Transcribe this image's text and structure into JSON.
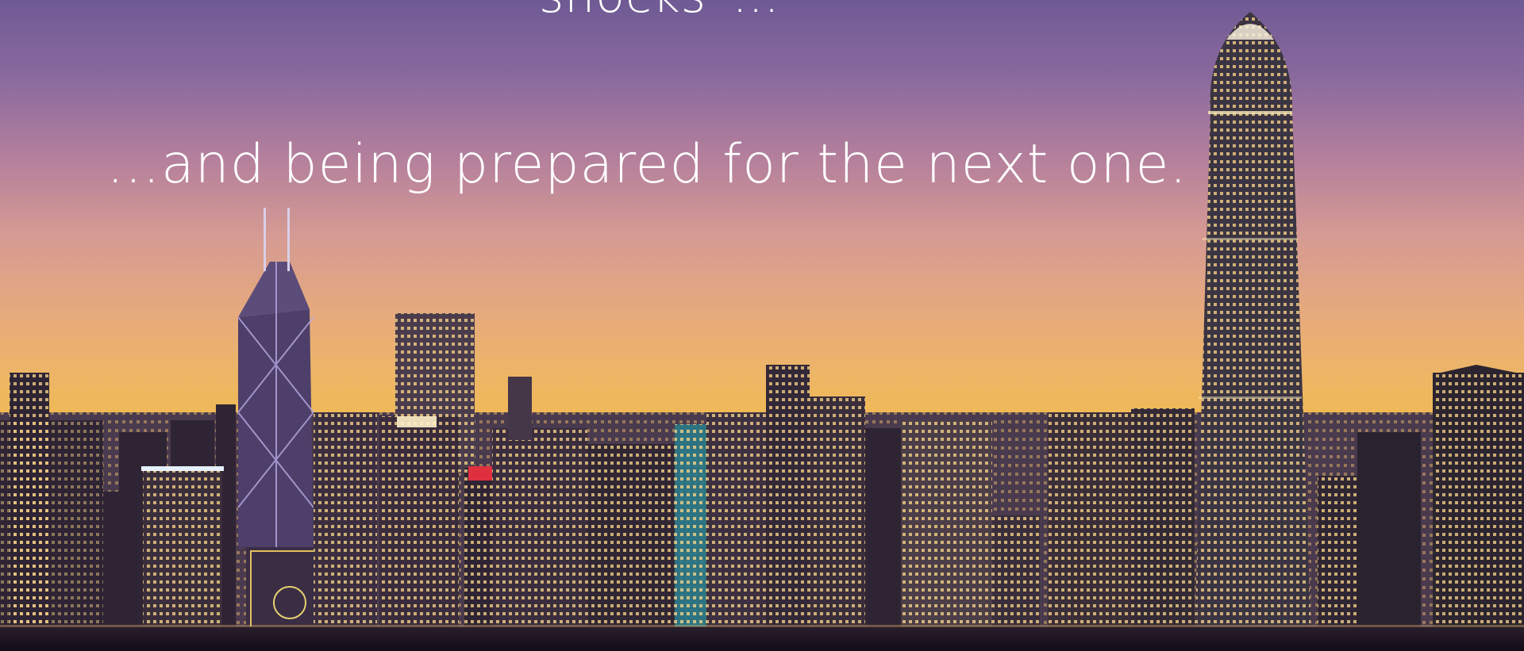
{
  "caption": {
    "line1": "“shocks”…",
    "line2": "…and being prepared for the next one."
  },
  "colors": {
    "sky_top": "#6f5a94",
    "sky_mid": "#d59a93",
    "sky_horizon": "#f0b950",
    "window_light": "#ffd98a"
  }
}
